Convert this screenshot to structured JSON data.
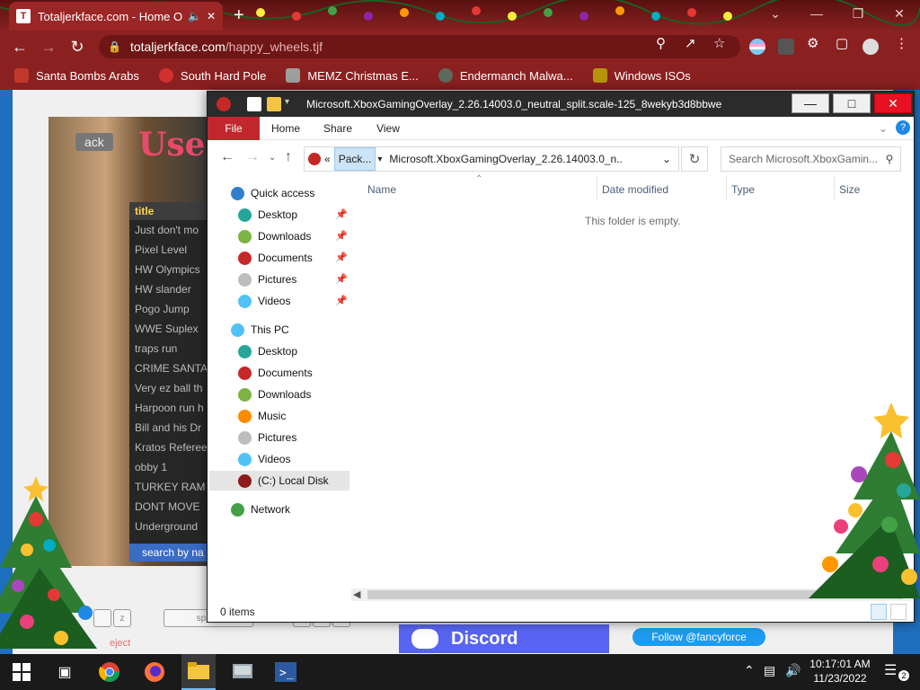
{
  "browser": {
    "tab_title": "Totaljerkface.com - Home Of",
    "url_host": "totaljerkface.com",
    "url_path": "/happy_wheels.tjf",
    "bookmarks": [
      {
        "label": "Santa Bombs Arabs",
        "color": "#c0392b"
      },
      {
        "label": "South Hard Pole",
        "color": "#d32f2f"
      },
      {
        "label": "MEMZ Christmas E...",
        "color": "#9e9e9e"
      },
      {
        "label": "Endermanch Malwa...",
        "color": "#5d6b5d"
      },
      {
        "label": "Windows ISOs",
        "color": "#b7950b"
      }
    ]
  },
  "game": {
    "title": "Use",
    "back_label": "ack",
    "list_header": "title",
    "levels": [
      "Just don't mo",
      "Pixel Level",
      "HW Olympics",
      "HW slander",
      "Pogo Jump",
      "WWE Suplex",
      "traps run",
      "CRIME SANTA",
      "Very ez ball th",
      "Harpoon run h",
      "Bill and his Dr",
      "Kratos Referee",
      "obby 1",
      "TURKEY RAM",
      "DONT MOVE",
      "Underground"
    ],
    "search_label": "search by na",
    "key_z": "z",
    "key_space": "space",
    "eject_label": "eject",
    "discord_label": "Discord",
    "twitter_label": "Follow @fancyforce"
  },
  "explorer": {
    "title": "Microsoft.XboxGamingOverlay_2.26.14003.0_neutral_split.scale-125_8wekyb3d8bbwe",
    "ribbon_tabs": [
      "File",
      "Home",
      "Share",
      "View"
    ],
    "address_overflow": "«",
    "address_segment": "Pack...",
    "address_path": "Microsoft.XboxGamingOverlay_2.26.14003.0_n...",
    "search_placeholder": "Search Microsoft.XboxGamin...",
    "nav": {
      "quick_access": "Quick access",
      "quick_items": [
        "Desktop",
        "Downloads",
        "Documents",
        "Pictures",
        "Videos"
      ],
      "this_pc": "This PC",
      "pc_items": [
        "Desktop",
        "Documents",
        "Downloads",
        "Music",
        "Pictures",
        "Videos",
        "(C:) Local Disk"
      ],
      "network": "Network"
    },
    "columns": [
      "Name",
      "Date modified",
      "Type",
      "Size"
    ],
    "empty_message": "This folder is empty.",
    "status": "0 items"
  },
  "taskbar": {
    "time": "10:17:01 AM",
    "date": "11/23/2022",
    "notification_count": "2"
  },
  "colors": {
    "chrome_red": "#8b2020",
    "file_tab": "#c1272d",
    "close_button": "#e81123",
    "discord": "#5865f2",
    "twitter": "#1d9bf0"
  }
}
